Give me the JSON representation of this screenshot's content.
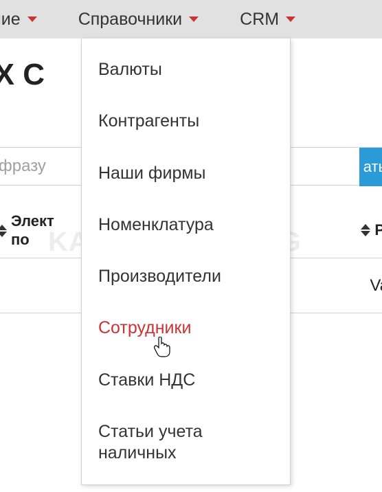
{
  "topbar": {
    "items": [
      {
        "label": "ние"
      },
      {
        "label": "Справочники"
      },
      {
        "label": "CRM"
      }
    ]
  },
  "page": {
    "title_fragment": "ИХ С"
  },
  "search": {
    "placeholder": "о фразу",
    "button_fragment": "ать"
  },
  "watermark": "KAK-SDELAT.ORG",
  "table": {
    "columns": [
      {
        "label": "Элект\nпо"
      },
      {
        "label": "Р"
      }
    ],
    "rows": [
      {
        "right_cell": "Va"
      }
    ]
  },
  "dropdown": {
    "items": [
      {
        "label": "Валюты",
        "active": false
      },
      {
        "label": "Контрагенты",
        "active": false
      },
      {
        "label": "Наши фирмы",
        "active": false
      },
      {
        "label": "Номенклатура",
        "active": false
      },
      {
        "label": "Производители",
        "active": false
      },
      {
        "label": "Сотрудники",
        "active": true
      },
      {
        "label": "Ставки НДС",
        "active": false
      },
      {
        "label": "Статьи учета наличных",
        "active": false
      }
    ]
  }
}
